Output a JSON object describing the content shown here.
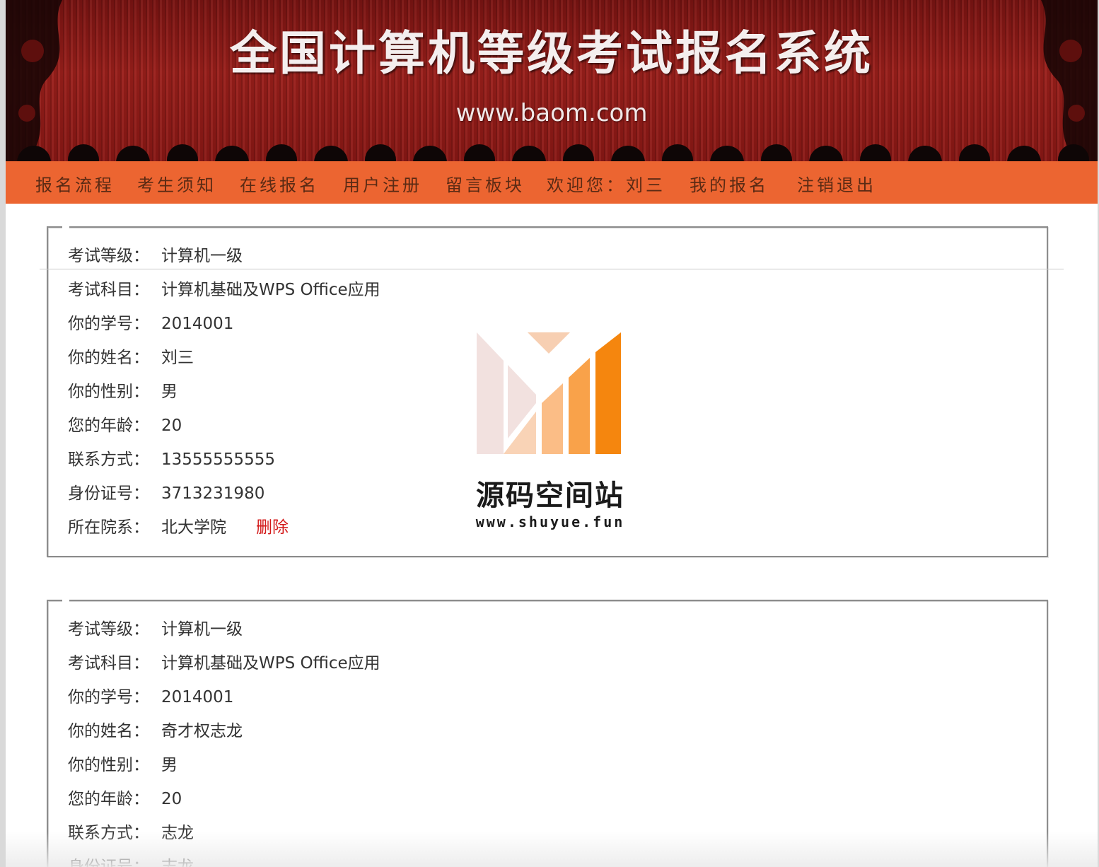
{
  "banner": {
    "title": "全国计算机等级考试报名系统",
    "url": "www.baom.com"
  },
  "nav": {
    "items": [
      "报名流程",
      "考生须知",
      "在线报名",
      "用户注册",
      "留言板块",
      "欢迎您：刘三",
      "我的报名",
      "注销退出"
    ]
  },
  "records": [
    {
      "rows": [
        {
          "label": "考试等级：",
          "value": "计算机一级"
        },
        {
          "label": "考试科目：",
          "value": "计算机基础及WPS Office应用"
        },
        {
          "label": "你的学号：",
          "value": "2014001"
        },
        {
          "label": "你的姓名：",
          "value": "刘三"
        },
        {
          "label": "你的性别：",
          "value": "男"
        },
        {
          "label": "您的年龄：",
          "value": "20"
        },
        {
          "label": "联系方式：",
          "value": "13555555555"
        },
        {
          "label": "身份证号：",
          "value": "3713231980"
        },
        {
          "label": "所在院系：",
          "value": "北大学院"
        }
      ],
      "delete_label": "删除"
    },
    {
      "rows": [
        {
          "label": "考试等级：",
          "value": "计算机一级"
        },
        {
          "label": "考试科目：",
          "value": "计算机基础及WPS Office应用"
        },
        {
          "label": "你的学号：",
          "value": "2014001"
        },
        {
          "label": "你的姓名：",
          "value": "奇才权志龙"
        },
        {
          "label": "你的性别：",
          "value": "男"
        },
        {
          "label": "您的年龄：",
          "value": "20"
        },
        {
          "label": "联系方式：",
          "value": "志龙"
        },
        {
          "label": "身份证号：",
          "value": "志龙"
        }
      ]
    }
  ],
  "watermark": {
    "name": "源码空间站",
    "url": "www.shuyue.fun"
  },
  "colors": {
    "banner": "#8a1815",
    "nav": "#ec6531",
    "nav_text": "#5a2a14",
    "delete": "#d31a1a"
  }
}
